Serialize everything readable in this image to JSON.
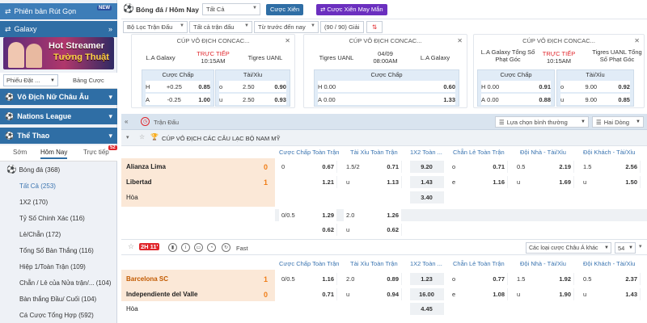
{
  "sidebar": {
    "short_version": "Phiên bản Rút Gọn",
    "galaxy": "Galaxy",
    "banner_line1": "Hot Streamer",
    "banner_line2": "Tường Thuật",
    "odds_type": "Phiếu Đặt ...",
    "bet_slip": "Bảng Cược",
    "nav": [
      {
        "label": "Vô Địch Nữ Châu Âu"
      },
      {
        "label": "Nations League"
      },
      {
        "label": "Thể Thao"
      }
    ],
    "tabs": [
      "Sớm",
      "Hôm Nay",
      "Trực tiếp"
    ],
    "live_count": "52",
    "sport": "Bóng đá",
    "sport_count": "(368)",
    "menu": [
      {
        "label": "Tất Cả",
        "count": "(253)"
      },
      {
        "label": "1X2",
        "count": "(170)"
      },
      {
        "label": "Tỷ Số Chính Xác",
        "count": "(116)"
      },
      {
        "label": "Lẻ/Chẵn",
        "count": "(172)"
      },
      {
        "label": "Tổng Số Bàn Thắng",
        "count": "(116)"
      },
      {
        "label": "Hiệp 1/Toàn Trận",
        "count": "(109)"
      },
      {
        "label": "Chẵn / Lẻ của Nửa trận/...",
        "count": "(104)"
      },
      {
        "label": "Bàn thắng Đầu/ Cuối",
        "count": "(104)"
      },
      {
        "label": "Cá Cược Tổng Hợp",
        "count": "(592)"
      }
    ]
  },
  "topbar": {
    "title": "Bóng đá / Hôm Nay",
    "select_all": "Tất Cả",
    "btn_single": "Cược Xiên",
    "btn_lucky": "Cược Xiên May Mắn"
  },
  "filters": {
    "league_filter": "Bộ Lọc Trận Đấu",
    "all_matches": "Tất cả trận đấu",
    "from_before": "Từ trước đến nay",
    "matches_count": "(90 / 90) Giải"
  },
  "cards": [
    {
      "league": "CÚP VÔ ĐỊCH CONCAC...",
      "home": "L.A Galaxy",
      "away": "Tigres UANL",
      "status": "TRỰC TIẾP",
      "time": "10:15AM",
      "hdp_label": "Cược Chấp",
      "ou_label": "Tài/Xỉu",
      "rows": [
        [
          "H",
          "+0.25",
          "0.85",
          "o",
          "2.50",
          "0.90"
        ],
        [
          "A",
          "-0.25",
          "1.00",
          "u",
          "2.50",
          "0.93"
        ]
      ]
    },
    {
      "league": "CÚP VÔ ĐỊCH CONCAC...",
      "home": "Tigres UANL",
      "away": "L.A Galaxy",
      "date": "04/09",
      "time": "08:00AM",
      "hdp_label": "Cược Chấp",
      "rows": [
        [
          "H",
          "0.00",
          "0.60"
        ],
        [
          "A",
          "0.00",
          "1.33"
        ]
      ]
    },
    {
      "league": "CÚP VÔ ĐỊCH CONCAC...",
      "home": "L.A Galaxy Tổng Số Phạt Góc",
      "away": "Tigres UANL Tổng Số Phạt Góc",
      "status": "TRỰC TIẾP",
      "time": "10:15AM",
      "hdp_label": "Cược Chấp",
      "ou_label": "Tài/Xỉu",
      "rows": [
        [
          "H",
          "0.00",
          "0.91",
          "o",
          "9.00",
          "0.92"
        ],
        [
          "A",
          "0.00",
          "0.88",
          "u",
          "9.00",
          "0.85"
        ]
      ]
    }
  ],
  "section": {
    "title": "Trận Đấu",
    "sort": "Lựa chọn bình thường",
    "lines": "Hai Dòng",
    "league": "CÚP VÔ ĐỊCH CÁC CÂU LẠC BỘ NAM MỸ"
  },
  "columns": [
    "Cược Chấp Toàn Trận",
    "Tài Xỉu Toàn Trận",
    "1X2 Toàn ...",
    "Chẵn Lẻ Toàn Trận",
    "Đội Nhà - Tài/Xỉu",
    "Đội Khách - Tài/Xỉu"
  ],
  "match1": {
    "home": "Alianza Lima",
    "away": "Libertad",
    "draw": "Hòa",
    "home_score": "0",
    "away_score": "1",
    "hdp": [
      [
        "0",
        "0.67"
      ],
      [
        "",
        "1.21"
      ]
    ],
    "ou": [
      [
        "1.5/2",
        "0.71"
      ],
      [
        "u",
        "1.13"
      ]
    ],
    "x12": [
      "9.20",
      "1.43",
      "3.40"
    ],
    "oe": [
      [
        "o",
        "0.71"
      ],
      [
        "e",
        "1.16"
      ]
    ],
    "home_ou": [
      [
        "0.5",
        "2.19"
      ],
      [
        "u",
        "1.69"
      ]
    ],
    "away_ou": [
      [
        "1.5",
        "2.56"
      ],
      [
        "u",
        "1.50"
      ]
    ],
    "alt_hdp": [
      [
        "0/0.5",
        "1.29"
      ],
      [
        "",
        "0.62"
      ]
    ],
    "alt_ou": [
      [
        "2.0",
        "1.26"
      ],
      [
        "u",
        "0.62"
      ]
    ]
  },
  "controls": {
    "live_time": "2H 11'",
    "fast": "Fast",
    "odds_select": "Các loại cược Châu Á khác",
    "count_select": "54"
  },
  "match2": {
    "home": "Barcelona SC",
    "away": "Independiente del Valle",
    "draw": "Hòa",
    "home_score": "1",
    "away_score": "0",
    "hdp": [
      [
        "0/0.5",
        "1.16"
      ],
      [
        "",
        "0.71"
      ]
    ],
    "ou": [
      [
        "2.0",
        "0.89"
      ],
      [
        "u",
        "0.94"
      ]
    ],
    "x12": [
      "1.23",
      "16.00",
      "4.45"
    ],
    "oe": [
      [
        "o",
        "0.77"
      ],
      [
        "e",
        "1.08"
      ]
    ],
    "home_ou": [
      [
        "1.5",
        "1.92"
      ],
      [
        "u",
        "1.90"
      ]
    ],
    "away_ou": [
      [
        "0.5",
        "2.37"
      ],
      [
        "u",
        "1.43"
      ]
    ]
  },
  "colors": {
    "primary": "#2f6ea5",
    "accent": "#e0262b",
    "score": "#f07d16",
    "header_bg": "#d9e4ef",
    "row_bg": "#fbe8d7"
  }
}
